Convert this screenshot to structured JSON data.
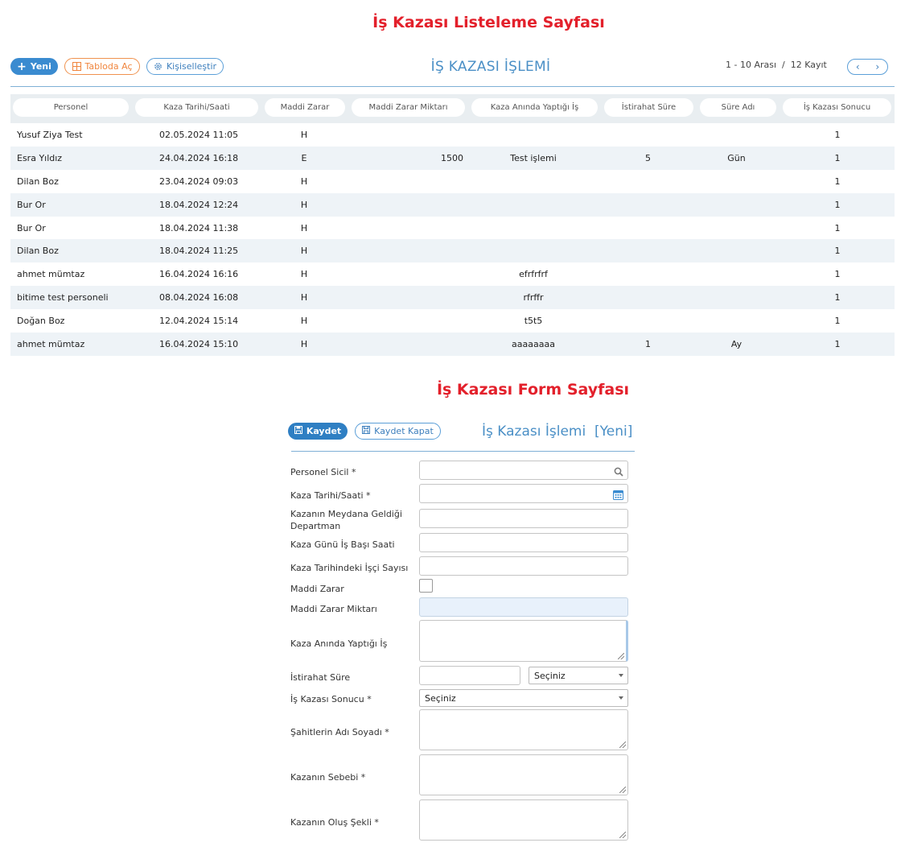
{
  "headings": {
    "list": "İş Kazası Listeleme Sayfası",
    "form": "İş Kazası Form Sayfası"
  },
  "toolbar": {
    "new_label": "Yeni",
    "excel_label": "Tabloda Aç",
    "personalize_label": "Kişiselleştir",
    "module_title": "İŞ KAZASI İŞLEMİ",
    "pager_text": "1 - 10 Arası  /  12 Kayıt",
    "prev": "‹",
    "next": "›"
  },
  "table": {
    "columns": [
      "Personel",
      "Kaza Tarihi/Saati",
      "Maddi Zarar",
      "Maddi Zarar Miktarı",
      "Kaza Anında Yaptığı İş",
      "İstirahat Süre",
      "Süre Adı",
      "İş Kazası Sonucu"
    ],
    "rows": [
      {
        "name": "Yusuf Ziya Test",
        "date": "02.05.2024 11:05",
        "mz": "H",
        "amount": "",
        "action": "",
        "rest": "",
        "unit": "",
        "result": "1"
      },
      {
        "name": "Esra Yıldız",
        "date": "24.04.2024 16:18",
        "mz": "E",
        "amount": "1500",
        "action": "Test işlemi",
        "rest": "5",
        "unit": "Gün",
        "result": "1"
      },
      {
        "name": "Dilan Boz",
        "date": "23.04.2024 09:03",
        "mz": "H",
        "amount": "",
        "action": "",
        "rest": "",
        "unit": "",
        "result": "1"
      },
      {
        "name": "Bur Or",
        "date": "18.04.2024 12:24",
        "mz": "H",
        "amount": "",
        "action": "",
        "rest": "",
        "unit": "",
        "result": "1"
      },
      {
        "name": "Bur Or",
        "date": "18.04.2024 11:38",
        "mz": "H",
        "amount": "",
        "action": "",
        "rest": "",
        "unit": "",
        "result": "1"
      },
      {
        "name": "Dilan Boz",
        "date": "18.04.2024 11:25",
        "mz": "H",
        "amount": "",
        "action": "",
        "rest": "",
        "unit": "",
        "result": "1"
      },
      {
        "name": "ahmet mümtaz",
        "date": "16.04.2024 16:16",
        "mz": "H",
        "amount": "",
        "action": "efrfrfrf",
        "rest": "",
        "unit": "",
        "result": "1"
      },
      {
        "name": "bitime test personeli",
        "date": "08.04.2024 16:08",
        "mz": "H",
        "amount": "",
        "action": "rfrffr",
        "rest": "",
        "unit": "",
        "result": "1"
      },
      {
        "name": "Doğan Boz",
        "date": "12.04.2024 15:14",
        "mz": "H",
        "amount": "",
        "action": "t5t5",
        "rest": "",
        "unit": "",
        "result": "1"
      },
      {
        "name": "ahmet mümtaz",
        "date": "16.04.2024 15:10",
        "mz": "H",
        "amount": "",
        "action": "aaaaaaaa",
        "rest": "1",
        "unit": "Ay",
        "result": "1"
      }
    ]
  },
  "form": {
    "save_label": "Kaydet",
    "save_close_label": "Kaydet Kapat",
    "title": "İş Kazası İşlemi  [Yeni]",
    "labels": {
      "personel": "Personel Sicil *",
      "date": "Kaza Tarihi/Saati *",
      "department": "Kazanın Meydana Geldiği Departman",
      "start_time": "Kaza Günü İş Başı Saati",
      "worker_count": "Kaza Tarihindeki İşçi Sayısı",
      "material_damage": "Maddi Zarar",
      "damage_amount": "Maddi Zarar Miktarı",
      "action": "Kaza Anında Yaptığı İş",
      "rest": "İstirahat Süre",
      "result": "İş Kazası Sonucu *",
      "witnesses": "Şahitlerin Adı Soyadı *",
      "cause": "Kazanın Sebebi *",
      "manner": "Kazanın Oluş Şekli *"
    },
    "rest_unit_value": "Seçiniz",
    "result_value": "Seçiniz"
  },
  "colors": {
    "heading": "#e3202b",
    "primary": "#3a8bd0",
    "excel": "#f0924e"
  }
}
